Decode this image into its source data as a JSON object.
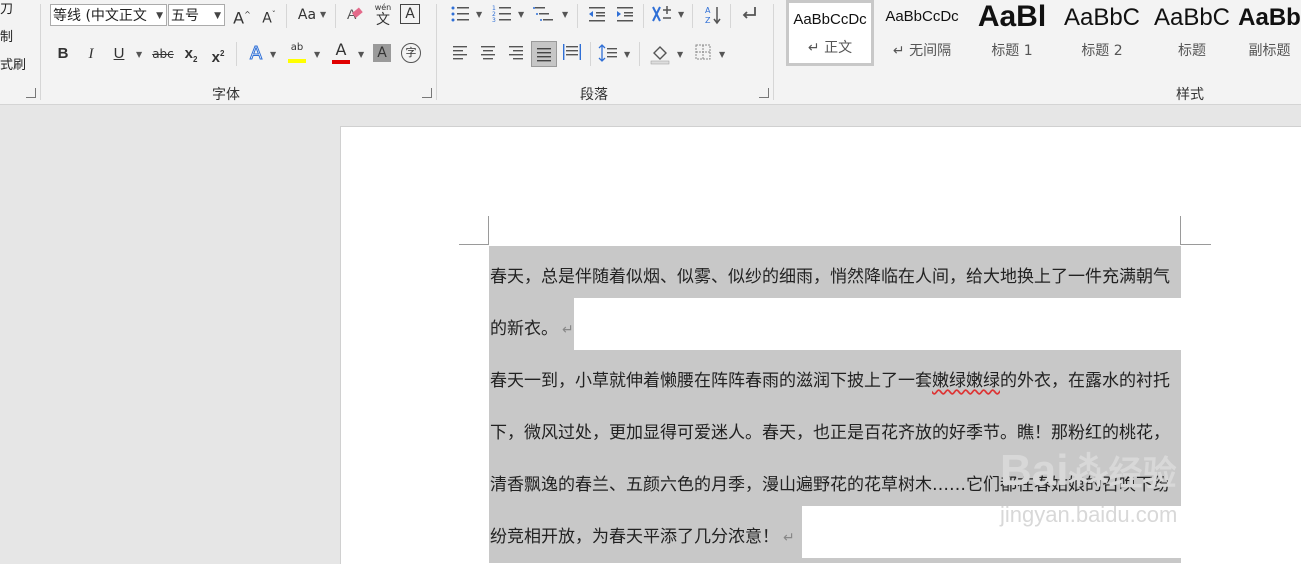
{
  "clipboard": {
    "partial_labels": [
      "刀",
      "制",
      "式刷"
    ]
  },
  "font_group": {
    "label": "字体",
    "font_name": "等线 (中文正文",
    "font_size": "五号",
    "grow_icon": "A",
    "shrink_icon": "A",
    "change_case": "Aa",
    "phonetic_top": "wén",
    "phonetic_char": "文",
    "char_border": "A",
    "bold": "B",
    "italic": "I",
    "underline": "U",
    "strike": "abc",
    "subscript": "x",
    "subscript_small": "2",
    "superscript": "x",
    "superscript_small": "2",
    "text_effects": "A",
    "highlight_ab": "ab",
    "font_color": "A",
    "char_shading": "A",
    "enclose": "字",
    "colors": {
      "highlight": "#ffff00",
      "font_color": "#e00000",
      "effects": "#2f6fd6"
    }
  },
  "paragraph_group": {
    "label": "段落",
    "sort": "A Z"
  },
  "styles_group": {
    "label": "样式",
    "items": [
      {
        "sample": "AaBbCcDc",
        "name": "↵ 正文"
      },
      {
        "sample": "AaBbCcDc",
        "name": "↵ 无间隔"
      },
      {
        "sample": "AaBl",
        "name": "标题 1"
      },
      {
        "sample": "AaBbC",
        "name": "标题 2"
      },
      {
        "sample": "AaBbC",
        "name": "标题"
      },
      {
        "sample": "AaBb",
        "name": "副标题"
      }
    ]
  },
  "document": {
    "lines": [
      "春天，总是伴随着似烟、似雾、似纱的细雨，悄然降临在人间，给大地换上了一件充满朝气",
      "的新衣。",
      "春天一到，小草就伸着懒腰在阵阵春雨的滋润下披上了一套",
      "的外衣，在露水的衬托",
      "下，微风过处，更加显得可爱迷人。春天，也正是百花齐放的好季节。瞧！那粉红的桃花，",
      "清香飘逸的春兰、五颜六色的月季，漫山遍野花的花草树木……它们都在春姑娘的召唤下纷",
      "纷竞相开放，为春天平添了几分浓意！"
    ],
    "wavy_word": "嫩绿嫩绿",
    "para_mark": "↵"
  },
  "watermark": {
    "brand": "Bai",
    "brand2": "经验",
    "url": "jingyan.baidu.com"
  }
}
